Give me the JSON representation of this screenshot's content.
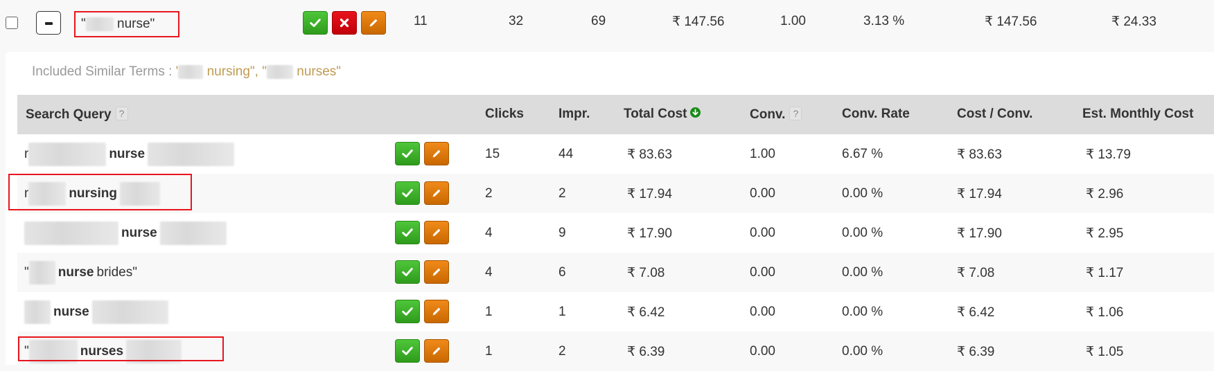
{
  "parent": {
    "term_prefix": "\"",
    "term_suffix": " nurse\"",
    "clicks": "11",
    "impressions": "32",
    "col3": "69",
    "total_cost": "₹ 147.56",
    "conversions": "1.00",
    "conv_rate": "3.13 %",
    "cost_per_conv": "₹ 147.56",
    "est_monthly_cost": "₹ 24.33",
    "actions": [
      "approve-icon",
      "reject-icon",
      "edit-icon"
    ]
  },
  "similar_terms": {
    "label": "Included Similar Terms : ",
    "term1_prefix": "'",
    "term1_suffix": " nursing\", ",
    "term2_prefix": "\"",
    "term2_suffix": " nurses\""
  },
  "table": {
    "headers": {
      "query": "Search Query",
      "clicks": "Clicks",
      "impr": "Impr.",
      "total_cost": "Total Cost",
      "conv": "Conv.",
      "conv_rate": "Conv. Rate",
      "cost_conv": "Cost / Conv.",
      "est_monthly": "Est. Monthly Cost"
    },
    "help_glyph": "?",
    "sort_icon": "sort-desc-icon",
    "rows": [
      {
        "pre": "r",
        "kw": "nurse",
        "post": "",
        "clicks": "15",
        "impr": "44",
        "cost": "₹ 83.63",
        "conv": "1.00",
        "rate": "6.67 %",
        "cpc": "₹ 83.63",
        "monthly": "₹ 13.79"
      },
      {
        "pre": "r",
        "kw": "nursing",
        "post": "",
        "clicks": "2",
        "impr": "2",
        "cost": "₹ 17.94",
        "conv": "0.00",
        "rate": "0.00 %",
        "cpc": "₹ 17.94",
        "monthly": "₹ 2.96"
      },
      {
        "pre": "",
        "kw": "nurse",
        "post": "",
        "clicks": "4",
        "impr": "9",
        "cost": "₹ 17.90",
        "conv": "0.00",
        "rate": "0.00 %",
        "cpc": "₹ 17.90",
        "monthly": "₹ 2.95"
      },
      {
        "pre": "\"",
        "kw": "nurse",
        "post": " brides\"",
        "clicks": "4",
        "impr": "6",
        "cost": "₹ 7.08",
        "conv": "0.00",
        "rate": "0.00 %",
        "cpc": "₹ 7.08",
        "monthly": "₹ 1.17"
      },
      {
        "pre": "",
        "kw": "nurse",
        "post": "",
        "clicks": "1",
        "impr": "1",
        "cost": "₹ 6.42",
        "conv": "0.00",
        "rate": "0.00 %",
        "cpc": "₹ 6.42",
        "monthly": "₹ 1.06"
      },
      {
        "pre": "\"",
        "kw": "nurses",
        "post": "",
        "clicks": "1",
        "impr": "2",
        "cost": "₹ 6.39",
        "conv": "0.00",
        "rate": "0.00 %",
        "cpc": "₹ 6.39",
        "monthly": "₹ 1.05"
      }
    ]
  },
  "colors": {
    "approve": "#3aad25",
    "reject": "#d00a10",
    "edit": "#df7a0c",
    "highlight_box": "#e8141c",
    "similar_term": "#c09a52"
  }
}
